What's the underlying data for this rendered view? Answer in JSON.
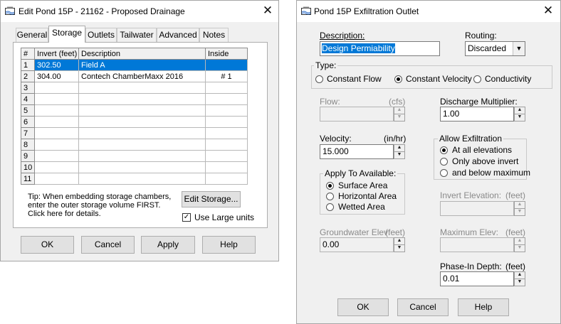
{
  "dialog1": {
    "title": "Edit Pond 15P - 21162 - Proposed Drainage",
    "tabs": [
      "General",
      "Storage",
      "Outlets",
      "Tailwater",
      "Advanced",
      "Notes"
    ],
    "active_tab": "Storage",
    "table": {
      "headers": [
        "#",
        "Invert (feet)",
        "Description",
        "Inside"
      ],
      "rows": [
        [
          "1",
          "302.50",
          "Field A",
          ""
        ],
        [
          "2",
          "304.00",
          "Contech ChamberMaxx 2016",
          "# 1"
        ],
        [
          "3",
          "",
          "",
          ""
        ],
        [
          "4",
          "",
          "",
          ""
        ],
        [
          "5",
          "",
          "",
          ""
        ],
        [
          "6",
          "",
          "",
          ""
        ],
        [
          "7",
          "",
          "",
          ""
        ],
        [
          "8",
          "",
          "",
          ""
        ],
        [
          "9",
          "",
          "",
          ""
        ],
        [
          "10",
          "",
          "",
          ""
        ],
        [
          "11",
          "",
          "",
          ""
        ]
      ]
    },
    "tip": [
      "Tip: When embedding storage chambers,",
      "enter the outer storage volume FIRST.",
      "Click here for details."
    ],
    "edit_storage": "Edit Storage...",
    "use_large_units": "Use Large units",
    "use_large_units_checked": true,
    "buttons": {
      "ok": "OK",
      "cancel": "Cancel",
      "apply": "Apply",
      "help": "Help"
    }
  },
  "dialog2": {
    "title": "Pond 15P Exfiltration Outlet",
    "description_label": "Description:",
    "description_value": "Design Permiability",
    "routing_label": "Routing:",
    "routing_value": "Discarded",
    "type_label": "Type:",
    "type_options": [
      "Constant Flow",
      "Constant Velocity",
      "Conductivity"
    ],
    "type_selected": "Constant Velocity",
    "flow_label": "Flow:",
    "flow_unit": "(cfs)",
    "flow_value": "",
    "discharge_label": "Discharge Multiplier:",
    "discharge_value": "1.00",
    "velocity_label": "Velocity:",
    "velocity_unit": "(in/hr)",
    "velocity_value": "15.000",
    "allow_exfil_label": "Allow Exfiltration",
    "allow_exfil_options": [
      "At all elevations",
      "Only above invert",
      "and below maximum"
    ],
    "allow_exfil_selected": "At all elevations",
    "apply_to_label": "Apply To Available:",
    "apply_to_options": [
      "Surface Area",
      "Horizontal Area",
      "Wetted Area"
    ],
    "apply_to_selected": "Surface Area",
    "invert_label": "Invert Elevation:",
    "invert_unit": "(feet)",
    "invert_value": "",
    "gw_label": "Groundwater Elev:",
    "gw_unit": "(feet)",
    "gw_value": "0.00",
    "max_label": "Maximum Elev:",
    "max_unit": "(feet)",
    "max_value": "",
    "phase_label": "Phase-In Depth:",
    "phase_unit": "(feet)",
    "phase_value": "0.01",
    "buttons": {
      "ok": "OK",
      "cancel": "Cancel",
      "help": "Help"
    }
  },
  "icons": {
    "close": "close-icon",
    "app": "pond-app-icon",
    "spin_up": "spin-up-icon",
    "spin_down": "spin-down-icon",
    "dropdown": "chevron-down-icon"
  },
  "colors": {
    "selection": "#0078d7",
    "dialog_bg": "#f0f0f0"
  }
}
